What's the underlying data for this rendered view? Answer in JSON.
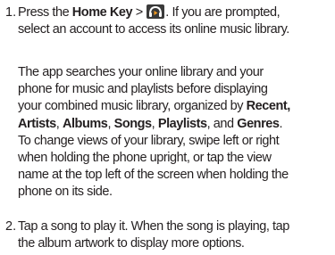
{
  "steps": [
    {
      "number": "1.",
      "lines": [
        {
          "pre": "Press the ",
          "bold": "Home Key",
          "mid": " > ",
          "icon": "play-music-headphones-icon",
          "post": ". If you are prompted,"
        },
        {
          "text": "select an account to access its online music library."
        }
      ]
    },
    {
      "number": "2.",
      "lines": [
        {
          "text": "Tap a song to play it. When the song is playing, tap"
        },
        {
          "text": "the album artwork to display more options."
        }
      ]
    }
  ],
  "note": {
    "line1": "The app searches your online library and your",
    "line2": "phone for music and playlists before displaying",
    "line3_pre": "your combined music library, organized by ",
    "line3_bold": "Recent,",
    "line4_bold1": "Artists",
    "line4_sep1": ", ",
    "line4_bold2": "Albums",
    "line4_sep2": ", ",
    "line4_bold3": "Songs",
    "line4_sep3": ", ",
    "line4_bold4": "Playlists",
    "line4_sep4": ", and ",
    "line4_bold5": "Genres",
    "line4_end": ".",
    "line5": "To change views of your library, swipe left or right",
    "line6": "when holding the phone upright, or tap the view",
    "line7": "name at the top left of the screen when holding the",
    "line8": "phone on its side."
  },
  "colors": {
    "text": "#231f20",
    "icon_bg": "#3a3a3a",
    "icon_accent": "#f29a1f"
  }
}
